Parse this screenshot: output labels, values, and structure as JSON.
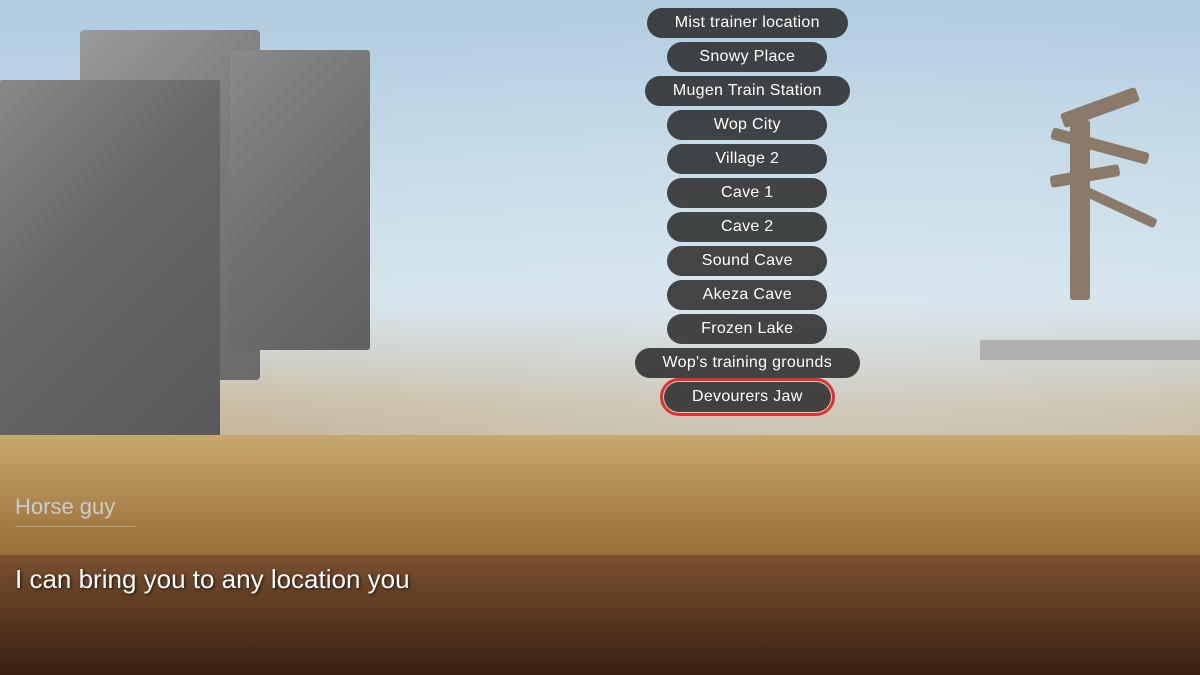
{
  "scene": {
    "npc_name": "Horse guy",
    "dialog_text": "I can bring you to any location you"
  },
  "menu": {
    "items": [
      {
        "id": "mist-trainer-location",
        "label": "Mist trainer location",
        "highlighted": false
      },
      {
        "id": "snowy-place",
        "label": "Snowy Place",
        "highlighted": false
      },
      {
        "id": "mugen-train-station",
        "label": "Mugen Train Station",
        "highlighted": false
      },
      {
        "id": "wop-city",
        "label": "Wop City",
        "highlighted": false
      },
      {
        "id": "village-2",
        "label": "Village 2",
        "highlighted": false
      },
      {
        "id": "cave-1",
        "label": "Cave 1",
        "highlighted": false
      },
      {
        "id": "cave-2",
        "label": "Cave 2",
        "highlighted": false
      },
      {
        "id": "sound-cave",
        "label": "Sound Cave",
        "highlighted": false
      },
      {
        "id": "akeza-cave",
        "label": "Akeza Cave",
        "highlighted": false
      },
      {
        "id": "frozen-lake",
        "label": "Frozen Lake",
        "highlighted": false
      },
      {
        "id": "wops-training-grounds",
        "label": "Wop's training grounds",
        "highlighted": false
      },
      {
        "id": "devourers-jaw",
        "label": "Devourers Jaw",
        "highlighted": true
      }
    ]
  }
}
